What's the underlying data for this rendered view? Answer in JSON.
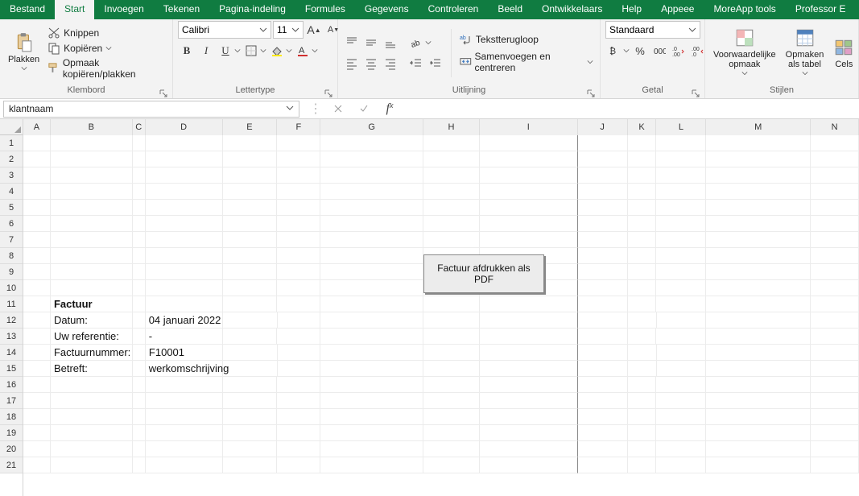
{
  "tabs": {
    "bestand": "Bestand",
    "start": "Start",
    "invoegen": "Invoegen",
    "tekenen": "Tekenen",
    "pagina": "Pagina-indeling",
    "formules": "Formules",
    "gegevens": "Gegevens",
    "controleren": "Controleren",
    "beeld": "Beeld",
    "ontwikkelaars": "Ontwikkelaars",
    "help": "Help",
    "appeee": "Appeee",
    "moreapp": "MoreApp tools",
    "professor": "Professor E"
  },
  "clipboard": {
    "paste": "Plakken",
    "cut": "Knippen",
    "copy": "Kopiëren",
    "fmtpaint": "Opmaak kopiëren/plakken",
    "label": "Klembord"
  },
  "font": {
    "name": "Calibri",
    "size": "11",
    "bold": "B",
    "italic": "I",
    "underline": "U",
    "increase": "A",
    "decrease": "A",
    "label": "Lettertype"
  },
  "align": {
    "wrap": "Tekstterugloop",
    "merge": "Samenvoegen en centreren",
    "label": "Uitlijning"
  },
  "number": {
    "format": "Standaard",
    "label": "Getal"
  },
  "styles": {
    "condfmt": "Voorwaardelijke opmaak",
    "astable": "Opmaken als tabel",
    "cellstyles": "Cels",
    "label": "Stijlen"
  },
  "fbar": {
    "name": "klantnaam",
    "formula": ""
  },
  "columns": [
    "A",
    "B",
    "C",
    "D",
    "E",
    "F",
    "G",
    "H",
    "I",
    "J",
    "K",
    "L",
    "M",
    "N"
  ],
  "rows": [
    "1",
    "2",
    "3",
    "4",
    "5",
    "6",
    "7",
    "8",
    "9",
    "10",
    "11",
    "12",
    "13",
    "14",
    "15",
    "16",
    "17",
    "18",
    "19",
    "20",
    "21"
  ],
  "sheet": {
    "b11": "Factuur",
    "b12": "Datum:",
    "d12": "04 januari 2022",
    "b13": "Uw referentie:",
    "d13": "-",
    "b14": "Factuurnummer:",
    "d14": "F10001",
    "b15": "Betreft:",
    "d15": "werkomschrijving",
    "btn": "Factuur afdrukken als PDF"
  }
}
